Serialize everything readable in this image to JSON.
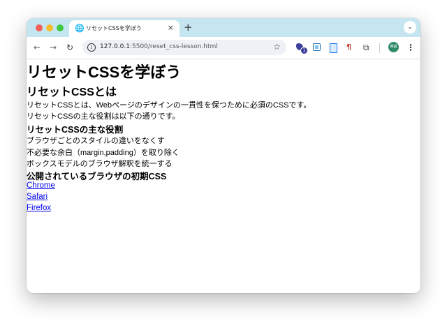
{
  "browser": {
    "tab": {
      "title": "リセットCSSを学ぼう",
      "favicon": "globe-icon",
      "close": "×"
    },
    "new_tab": "+",
    "tab_menu": "⌄",
    "nav": {
      "back": "←",
      "forward": "→",
      "reload": "↻"
    },
    "address": {
      "host": "127.0.0.1",
      "rest": ":5500/reset_css-lesson.html"
    },
    "extensions": {
      "badge_count": "1"
    },
    "profile_label": "英語",
    "menu": "⋮"
  },
  "page": {
    "h1": "リセットCSSを学ぼう",
    "section1": {
      "heading": "リセットCSSとは",
      "p1": "リセットCSSとは、Webページのデザインの一貫性を保つために必須のCSSです。",
      "p2": "リセットCSSの主な役割は以下の通りです。"
    },
    "section2": {
      "heading": "リセットCSSの主な役割",
      "items": [
        "ブラウザごとのスタイルの違いをなくす",
        "不必要な余白（margin,padding）を取り除く",
        "ボックスモデルのブラウザ解釈を統一する"
      ]
    },
    "section3": {
      "heading": "公開されているブラウザの初期CSS",
      "links": [
        "Chrome",
        "Safari",
        "Firefox"
      ]
    }
  },
  "colors": {
    "tabstrip": "#c5e6f0",
    "link": "#0000ee",
    "profile": "#2e8b66"
  }
}
